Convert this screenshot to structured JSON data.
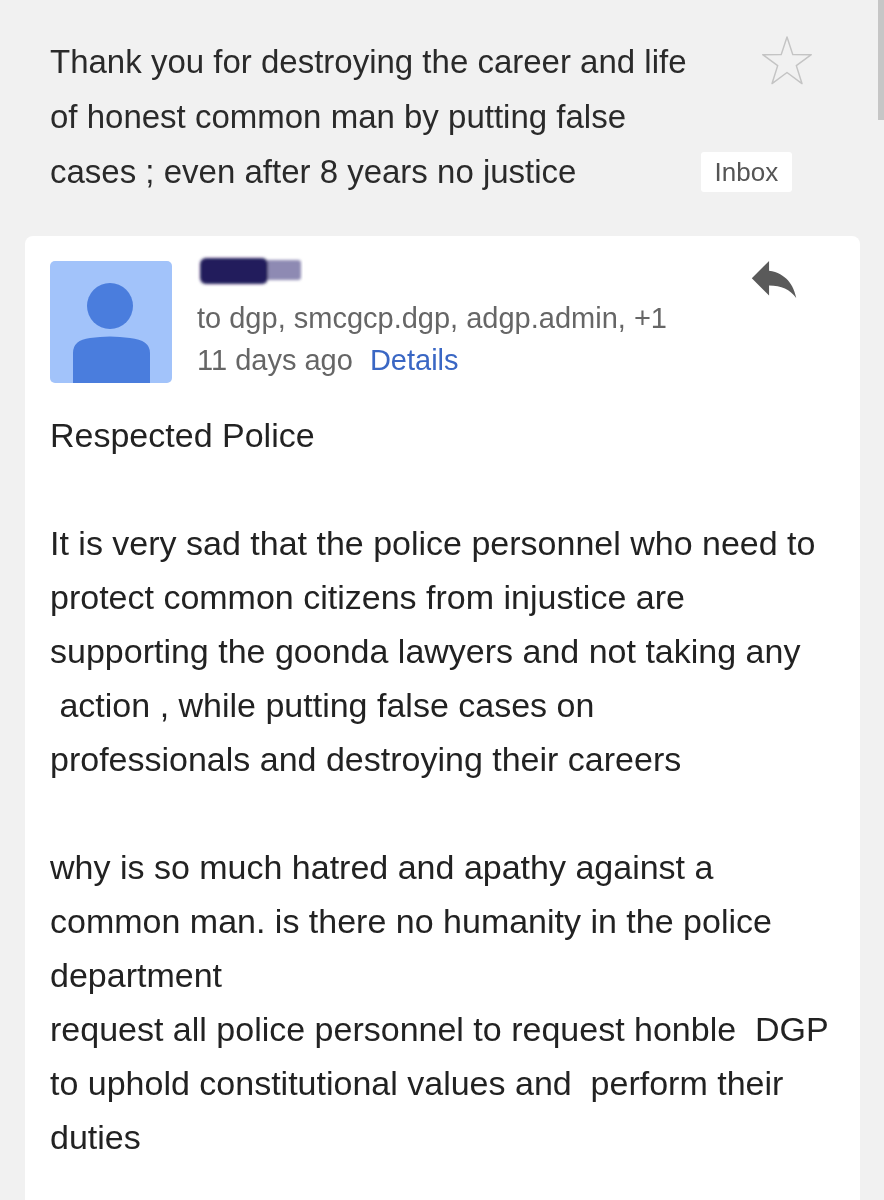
{
  "subject": {
    "text": "Thank you for destroying the career and life\nof honest common man by putting false\ncases ; even after 8 years no justice",
    "label": "Inbox",
    "starred": false
  },
  "message": {
    "recipients": "to dgp, smcgcp.dgp, adgp.admin, +1",
    "time": "11 days ago",
    "details_link": "Details",
    "body": [
      "Respected Police",
      "It is very sad that the police personnel who need to\nprotect common citizens from injustice are\nsupporting the goonda lawyers and not taking any\n action , while putting false cases on\nprofessionals and destroying their careers",
      "why is so much hatred and apathy against a\ncommon man. is there no humanity in the police\ndepartment\nrequest all police personnel to request honble  DGP\nto uphold constitutional values and  perform their\nduties"
    ]
  }
}
